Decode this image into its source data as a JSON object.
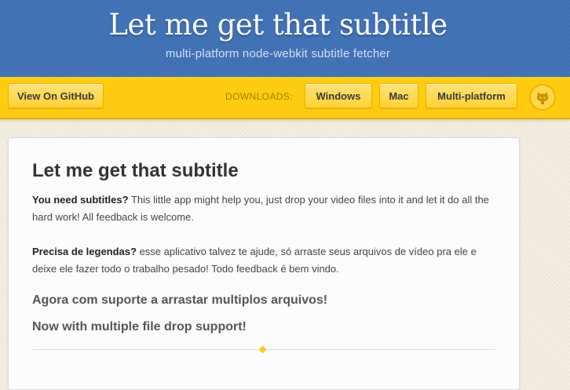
{
  "header": {
    "title": "Let me get that subtitle",
    "subtitle": "multi-platform node-webkit subtitle fetcher"
  },
  "toolbar": {
    "github_label": "View On GitHub",
    "downloads_label": "DOWNLOADS:",
    "windows_label": "Windows",
    "mac_label": "Mac",
    "multiplatform_label": "Multi-platform",
    "github_icon": "github-octocat-icon"
  },
  "main": {
    "title": "Let me get that subtitle",
    "intro_en": {
      "bold": "You need subtitles?",
      "rest": " This little app might help you, just drop your video files into it and let it do all the hard work! All feedback is welcome."
    },
    "intro_pt": {
      "bold": "Precisa de legendas?",
      "rest": " esse aplicativo talvez te ajude, só arraste seus arquivos de vídeo pra ele e deixe ele fazer todo o trabalho pesado! Todo feedback é bem vindo."
    },
    "feature_pt": "Agora com suporte a arrastar multiplos arquivos!",
    "feature_en": "Now with multiple file drop support!"
  },
  "colors": {
    "header_blue": "#3f70b5",
    "bar_yellow": "#ffcc11",
    "text_dark": "#333333"
  }
}
